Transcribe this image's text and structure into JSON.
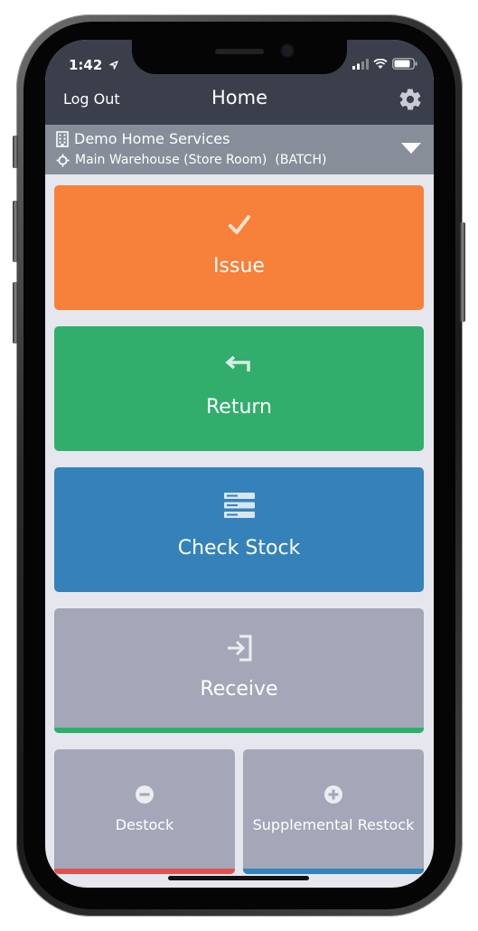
{
  "status": {
    "time": "1:42"
  },
  "navbar": {
    "logout_label": "Log Out",
    "title": "Home"
  },
  "location": {
    "company": "Demo Home Services",
    "warehouse": "Main Warehouse (Store Room)",
    "mode": "(BATCH)"
  },
  "tiles": {
    "issue": {
      "label": "Issue",
      "color": "#f7803a",
      "icon": "checkmark-icon"
    },
    "return": {
      "label": "Return",
      "color": "#31ae6c",
      "icon": "return-arrow-icon"
    },
    "check_stock": {
      "label": "Check Stock",
      "color": "#3482b9",
      "icon": "stack-icon"
    },
    "receive": {
      "label": "Receive",
      "color": "#a3a7b7",
      "accent": "#31ae6c",
      "icon": "sign-in-icon"
    },
    "destock": {
      "label": "Destock",
      "color": "#a3a7b7",
      "accent": "#e05353",
      "icon": "minus-circle-icon"
    },
    "supplemental_restock": {
      "label": "Supplemental Restock",
      "color": "#a3a7b7",
      "accent": "#3482b9",
      "icon": "plus-circle-icon"
    }
  },
  "colors": {
    "header": "#3a3f4b",
    "location_bar": "#878e99",
    "background": "#e6e7ee"
  }
}
